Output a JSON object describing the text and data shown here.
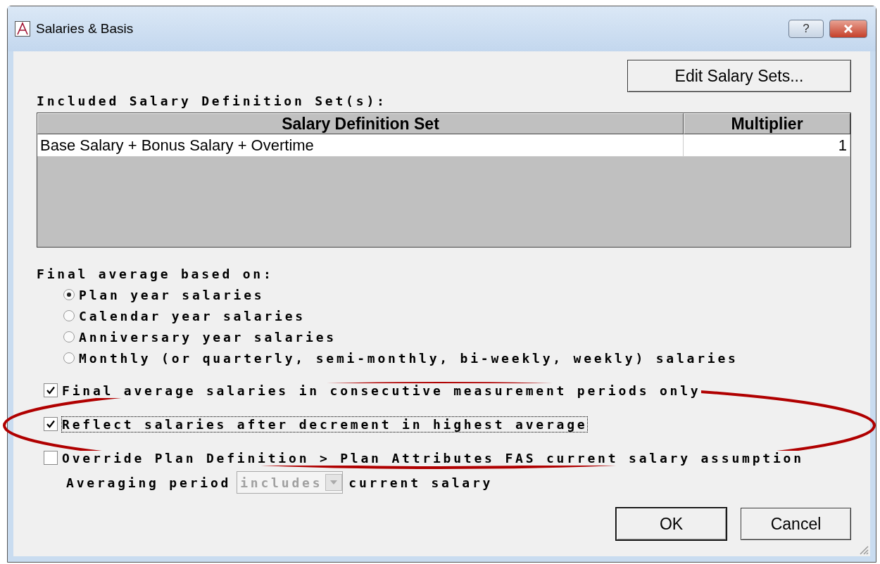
{
  "window": {
    "title": "Salaries & Basis",
    "help_label": "?"
  },
  "edit_button": {
    "label": "Edit Salary Sets..."
  },
  "included_label": "Included Salary Definition Set(s):",
  "table": {
    "columns": [
      "Salary Definition Set",
      "Multiplier"
    ],
    "rows": [
      [
        "Base Salary + Bonus Salary + Overtime",
        "1"
      ]
    ]
  },
  "final_average": {
    "label": "Final average based on:",
    "options": [
      {
        "label": "Plan year salaries",
        "selected": true
      },
      {
        "label": "Calendar year salaries",
        "selected": false
      },
      {
        "label": "Anniversary year salaries",
        "selected": false
      },
      {
        "label": "Monthly (or quarterly, semi-monthly, bi-weekly, weekly) salaries",
        "selected": false
      }
    ]
  },
  "checkboxes": [
    {
      "label": "Final average salaries in consecutive measurement periods only",
      "checked": true,
      "focused": false
    },
    {
      "label": "Reflect salaries after decrement in highest average",
      "checked": true,
      "focused": true
    },
    {
      "label": "Override Plan Definition > Plan Attributes FAS current salary assumption",
      "checked": false,
      "focused": false
    }
  ],
  "averaging": {
    "prefix": "Averaging period",
    "dropdown": {
      "value": "includes",
      "disabled": true
    },
    "suffix": "current salary"
  },
  "buttons": [
    {
      "label": "OK",
      "default": true
    },
    {
      "label": "Cancel",
      "default": false
    }
  ],
  "annotation": {
    "kind": "ellipse"
  }
}
